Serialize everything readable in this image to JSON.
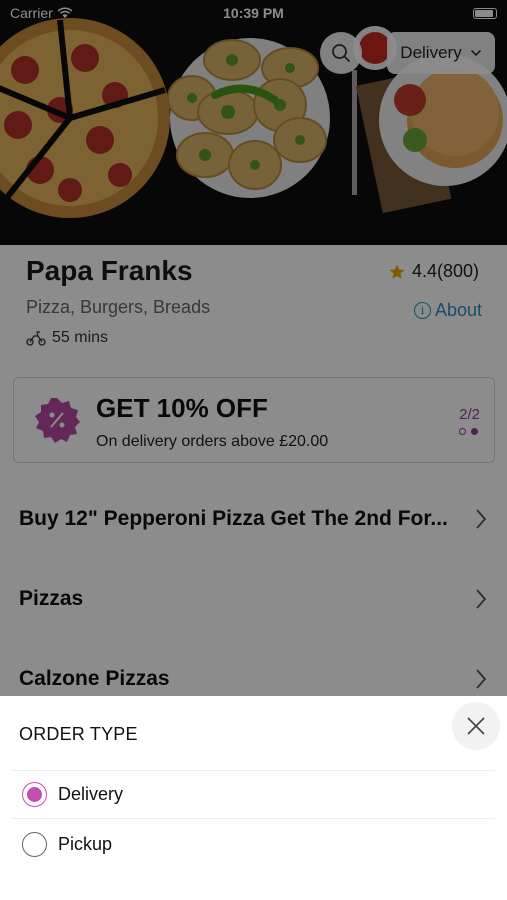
{
  "status_bar": {
    "carrier": "Carrier",
    "time": "10:39 PM"
  },
  "header": {
    "order_type_label": "Delivery"
  },
  "restaurant": {
    "name": "Papa Franks",
    "rating": "4.4(800)",
    "cuisines": "Pizza, Burgers, Breads",
    "about_label": "About",
    "eta": "55 mins"
  },
  "offer": {
    "title": "GET 10% OFF",
    "subtitle": "On delivery orders above £20.00",
    "counter": "2/2",
    "current_index": 2,
    "total": 2
  },
  "categories": [
    {
      "label": "Buy 12\" Pepperoni Pizza Get The 2nd For..."
    },
    {
      "label": "Pizzas"
    },
    {
      "label": "Calzone Pizzas"
    }
  ],
  "order_type_sheet": {
    "title": "ORDER TYPE",
    "options": [
      {
        "label": "Delivery",
        "selected": true
      },
      {
        "label": "Pickup",
        "selected": false
      }
    ]
  },
  "colors": {
    "accent": "#c44fb0",
    "link": "#2a8fbf",
    "star": "#f0a500"
  }
}
